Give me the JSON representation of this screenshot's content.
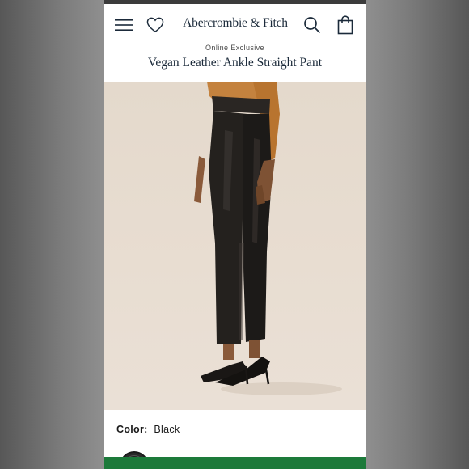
{
  "header": {
    "logo_text": "Abercrombie & Fitch",
    "icons": [
      "menu-icon",
      "heart-icon",
      "search-icon",
      "shopping-bag-icon"
    ]
  },
  "product": {
    "badge": "Online Exclusive",
    "title": "Vegan Leather Ankle Straight Pant"
  },
  "color_selector": {
    "label": "Color:",
    "value": "Black"
  },
  "colors": {
    "brand_text": "#1b2a3a",
    "promo_bar": "#1c7a3a",
    "status_bar": "#3b3b3b"
  }
}
